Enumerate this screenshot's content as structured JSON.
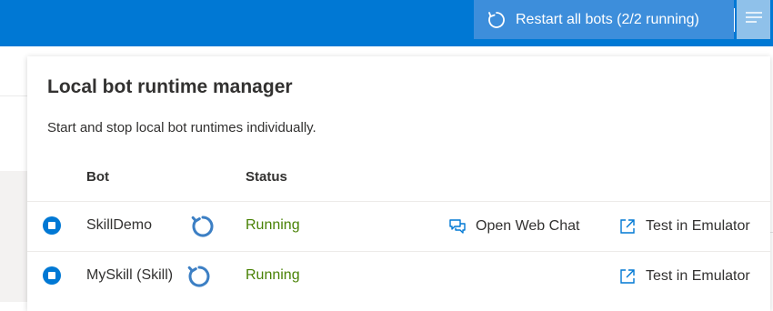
{
  "toolbar": {
    "restart_label": "Restart all bots (2/2 running)",
    "restart_icon": "refresh-icon",
    "menu_icon": "menu-icon"
  },
  "panel": {
    "title": "Local bot runtime manager",
    "subtitle": "Start and stop local bot runtimes individually.",
    "columns": {
      "bot": "Bot",
      "status": "Status"
    },
    "rows": [
      {
        "name": "SkillDemo",
        "status": "Running",
        "open_web_chat": "Open Web Chat",
        "test_in_emulator": "Test in Emulator"
      },
      {
        "name": "MySkill (Skill)",
        "status": "Running",
        "test_in_emulator": "Test in Emulator"
      }
    ]
  },
  "colors": {
    "accent": "#0078d4",
    "running": "#498205",
    "restart_button_bg": "#3d8edb",
    "menu_button_bg": "#8fc1ea"
  }
}
